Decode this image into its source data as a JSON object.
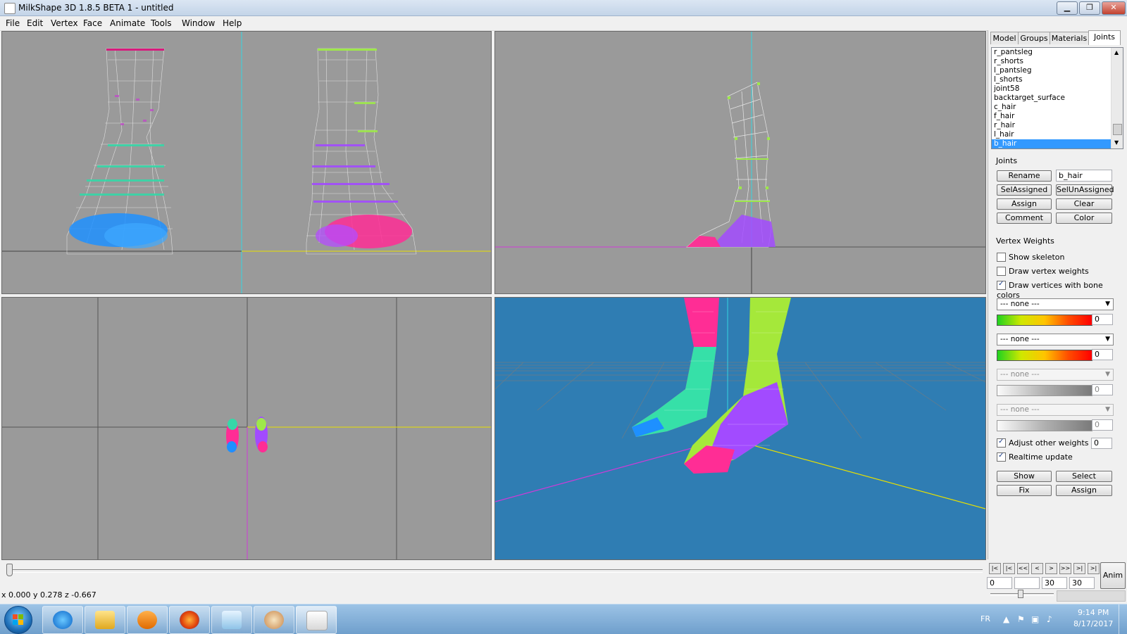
{
  "window": {
    "title": "MilkShape 3D 1.8.5 BETA 1 - untitled",
    "minimize_label": "▁",
    "restore_label": "❐",
    "close_label": "✕"
  },
  "menu": [
    "File",
    "Edit",
    "Vertex",
    "Face",
    "Animate",
    "Tools",
    "Window",
    "Help"
  ],
  "tabs": [
    "Model",
    "Groups",
    "Materials",
    "Joints"
  ],
  "active_tab": "Joints",
  "joints": {
    "list": [
      "r_pantsleg",
      "r_shorts",
      "l_pantsleg",
      "l_shorts",
      "joint58",
      "backtarget_surface",
      "c_hair",
      "f_hair",
      "r_hair",
      "l_hair",
      "b_hair"
    ],
    "selected": "b_hair",
    "section_label": "Joints",
    "rename_label": "Rename",
    "name_value": "b_hair",
    "selassigned_label": "SelAssigned",
    "selunassigned_label": "SelUnAssigned",
    "assign_label": "Assign",
    "clear_label": "Clear",
    "comment_label": "Comment",
    "color_label": "Color"
  },
  "vertex_weights": {
    "section_label": "Vertex Weights",
    "show_skeleton": {
      "label": "Show skeleton",
      "checked": false
    },
    "draw_vertex_weights": {
      "label": "Draw vertex weights",
      "checked": false
    },
    "draw_bone_colors": {
      "label": "Draw vertices with bone colors",
      "checked": true
    },
    "bone_slots": [
      {
        "joint": "--- none ---",
        "value": "0",
        "enabled": true
      },
      {
        "joint": "--- none ---",
        "value": "0",
        "enabled": true
      },
      {
        "joint": "--- none ---",
        "value": "0",
        "enabled": false
      },
      {
        "joint": "--- none ---",
        "value": "0",
        "enabled": false
      }
    ],
    "adjust_other": {
      "label": "Adjust other weights",
      "checked": true,
      "value": "0"
    },
    "realtime_update": {
      "label": "Realtime update",
      "checked": true
    },
    "show_label": "Show",
    "select_label": "Select",
    "fix_label": "Fix",
    "assign_label": "Assign"
  },
  "animation": {
    "frame_start": "0",
    "frame_current": "",
    "frame_end": "30",
    "frame_total": "30",
    "anim_label": "Anim",
    "buttons": [
      "|<",
      "|<",
      "<<",
      "<",
      ">",
      ">>",
      ">|",
      ">|"
    ]
  },
  "status": {
    "coords": "x 0.000 y 0.278 z -0.667"
  },
  "taskbar": {
    "apps": [
      "Internet Explorer",
      "Windows Explorer",
      "Media Player",
      "Firefox",
      "Notepad",
      "Paint",
      "MilkShape 3D"
    ],
    "language": "FR",
    "time": "9:14 PM",
    "date": "8/17/2017"
  },
  "colors": {
    "viewport_bg": "#9a9a9a",
    "viewport_3d_bg": "#2f7db3",
    "selection": "#3399ff",
    "axis_cyan": "#35d4e0",
    "axis_yellow": "#e8e000",
    "axis_magenta": "#d03ad8"
  }
}
